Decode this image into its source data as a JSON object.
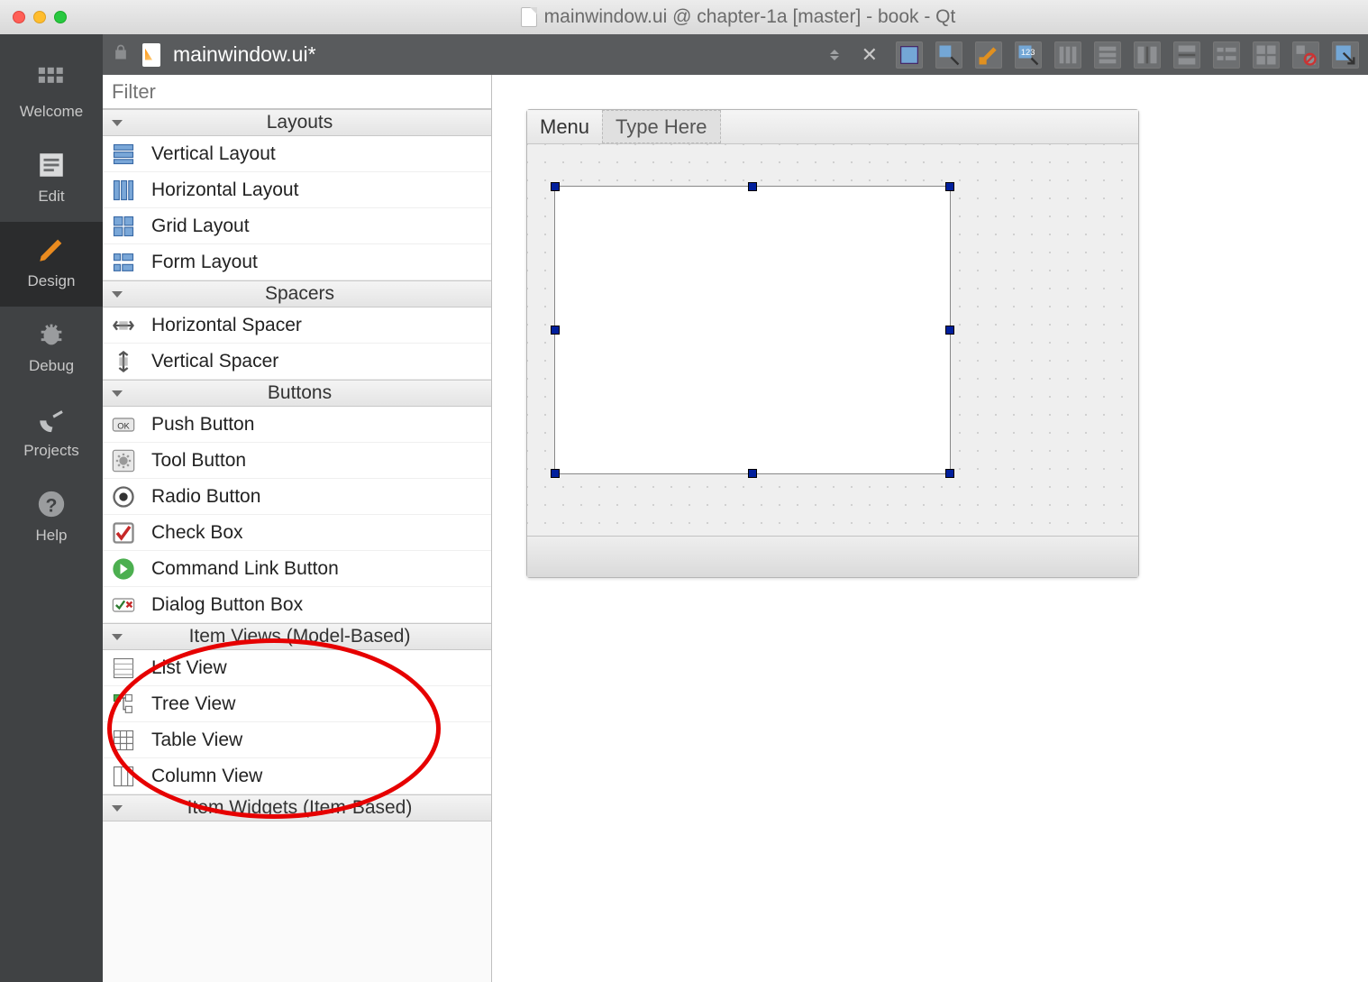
{
  "titlebar": {
    "title": "mainwindow.ui @ chapter-1a [master] - book - Qt"
  },
  "tabbar": {
    "doc_name": "mainwindow.ui*"
  },
  "rail": {
    "items": [
      {
        "id": "welcome",
        "label": "Welcome"
      },
      {
        "id": "edit",
        "label": "Edit"
      },
      {
        "id": "design",
        "label": "Design"
      },
      {
        "id": "debug",
        "label": "Debug"
      },
      {
        "id": "projects",
        "label": "Projects"
      },
      {
        "id": "help",
        "label": "Help"
      }
    ],
    "active": "design"
  },
  "widgetbox": {
    "filter_placeholder": "Filter",
    "categories": [
      {
        "label": "Layouts",
        "widgets": [
          {
            "label": "Vertical Layout",
            "icon": "vlayout"
          },
          {
            "label": "Horizontal Layout",
            "icon": "hlayout"
          },
          {
            "label": "Grid Layout",
            "icon": "gridlayout"
          },
          {
            "label": "Form Layout",
            "icon": "formlayout"
          }
        ]
      },
      {
        "label": "Spacers",
        "widgets": [
          {
            "label": "Horizontal Spacer",
            "icon": "hspacer"
          },
          {
            "label": "Vertical Spacer",
            "icon": "vspacer"
          }
        ]
      },
      {
        "label": "Buttons",
        "widgets": [
          {
            "label": "Push Button",
            "icon": "pushbutton"
          },
          {
            "label": "Tool Button",
            "icon": "toolbutton"
          },
          {
            "label": "Radio Button",
            "icon": "radiobutton"
          },
          {
            "label": "Check Box",
            "icon": "checkbox"
          },
          {
            "label": "Command Link Button",
            "icon": "cmdlink"
          },
          {
            "label": "Dialog Button Box",
            "icon": "dlgbtnbox"
          }
        ]
      },
      {
        "label": "Item Views (Model-Based)",
        "widgets": [
          {
            "label": "List View",
            "icon": "listview"
          },
          {
            "label": "Tree View",
            "icon": "treeview"
          },
          {
            "label": "Table View",
            "icon": "tableview"
          },
          {
            "label": "Column View",
            "icon": "columnview"
          }
        ]
      },
      {
        "label": "Item Widgets (Item-Based)",
        "widgets": []
      }
    ]
  },
  "canvas": {
    "menu_label": "Menu",
    "type_here": "Type Here"
  },
  "annotation_circle": true
}
